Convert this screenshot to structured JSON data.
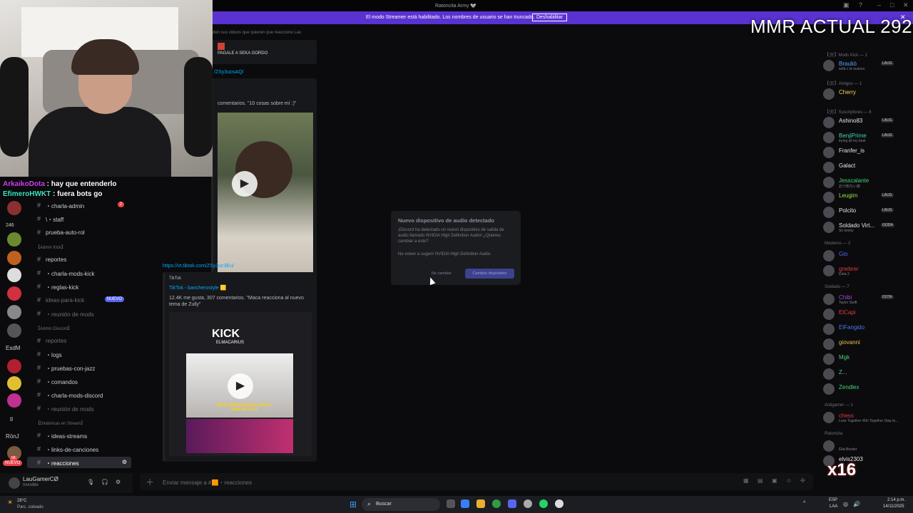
{
  "window": {
    "title": "Ratoncita Army 🐭"
  },
  "banner": {
    "text": "El modo Streamer está habilitado. Los nombres de usuario se han truncado.",
    "button": "Deshabilitar"
  },
  "overlay": {
    "mmr": "MMR ACTUAL 292",
    "x16": "x16"
  },
  "stream_chat": [
    {
      "user": "ArkaikoDota",
      "text": "hay que entenderlo"
    },
    {
      "user": "EfimeroHWKT",
      "text": "fuera bots go"
    }
  ],
  "server_rail": {
    "labels": [
      "246",
      "EsdM",
      "tl",
      "RönJ"
    ],
    "nuevo": "NUEVO",
    "badge": "68"
  },
  "channels": {
    "items": [
      {
        "label": "・charla-admin",
        "badge": "2"
      },
      {
        "label": "\\・staff"
      },
      {
        "label": "prueba-auto-rol"
      },
      {
        "category": "【Admin Kick】"
      },
      {
        "label": "reportes"
      },
      {
        "label": "・charla-mods-kick"
      },
      {
        "label": "・reglas-kick"
      },
      {
        "label": "ideas-para-kick",
        "badge": "NUEVO",
        "dim": true
      },
      {
        "label": "・reunión de mods",
        "dim": true
      },
      {
        "category": "【Admin Discord】"
      },
      {
        "label": "reportes",
        "dim": true
      },
      {
        "label": "・logs"
      },
      {
        "label": "・pruebas-con-jazz"
      },
      {
        "label": "・comandos"
      },
      {
        "label": "・charla-mods-discord"
      },
      {
        "label": "・reunión de mods",
        "dim": true
      },
      {
        "category": "【Dinámicas en Stream】"
      },
      {
        "label": "・ideas-streams"
      },
      {
        "label": "・links-de-canciones"
      },
      {
        "label": "・reacciones",
        "selected": true
      }
    ]
  },
  "user": {
    "name": "LauGamerCØ",
    "status": "Invisible"
  },
  "topic": "den sus videos que quieren que reaccione Lau",
  "messages": {
    "embed1_title": "PAGALE A SEKA GORDO",
    "link1": "/ZSy3uosAQ/",
    "embed2_desc": "comentarios. \"10 cosas sobre mí :)\"",
    "link2": "https://vt.tiktok.com/ZSy3uc3Eu/",
    "embed3_provider": "TikTok",
    "embed3_title": "TikTok - bancherostyle 🟨",
    "embed3_desc": "12.4K me gusta, 307 comentarios. \"Maca reacciona al nuevo tema de Zully\"",
    "thumb_kick": "KICK",
    "thumb_sub": "ELMACARIUS",
    "thumb_caption": "MAQUI REACCIONA AL NUEVO TEMA DE ZULLY"
  },
  "modal": {
    "title": "Nuevo dispositivo de audio detectado",
    "body": "¡Discord ha detectado un nuevo dispositivo de salida de audio llamado NVIDIA High Definition Audio! ¿Quieres cambiar a este?",
    "checkbox": "No volver a sugerir NVIDIA High Definition Audio.",
    "cancel": "No cambiar",
    "confirm": "Cambiar dispositivo"
  },
  "composer": {
    "placeholder": "Enviar mensaje a #🟧・reacciones"
  },
  "members": {
    "groups": [
      {
        "header": "【🛠】Mods Kick — 1",
        "members": [
          {
            "name": "Braulió",
            "status": "sefa c te avanzo",
            "color": "#5aa0ff",
            "tag": "LAUG"
          }
        ]
      },
      {
        "header": "【🛠】Amigos — 1",
        "members": [
          {
            "name": "Cherry",
            "color": "#ffd24a"
          }
        ]
      },
      {
        "header": "【🛠】Suscriptores — 8",
        "members": [
          {
            "name": "Ashino83",
            "color": "#e6e6e6",
            "tag": "LAUG"
          },
          {
            "name": "BenjiPrime",
            "status": "trying all my best",
            "color": "#3fd4b0",
            "tag": "LAUG"
          },
          {
            "name": "Franfer_is",
            "color": "#e6e6e6"
          },
          {
            "name": "Galact",
            "color": "#e6e6e6"
          },
          {
            "name": "Jesscalante",
            "status": "お汁粉ない旅",
            "color": "#4ad07a"
          },
          {
            "name": "Leugim",
            "color": "#9ae64a",
            "tag": "LAUG"
          },
          {
            "name": "Polcito",
            "color": "#e6e6e6",
            "tag": "LAUG"
          },
          {
            "name": "Soldado Virt...",
            "status": "So lonely",
            "color": "#e6e6e6",
            "tag": "GODA"
          }
        ]
      },
      {
        "header": "Moderno — 2",
        "members": [
          {
            "name": "Gio",
            "color": "#5865f2"
          },
          {
            "name": "gnebrer",
            "status": "Dota 2",
            "color": "#e03a3a"
          }
        ]
      },
      {
        "header": "Soldado — 7",
        "members": [
          {
            "name": "Chibi",
            "status": "Taylor Swift",
            "color": "#a04ad0",
            "tag": "DOTA"
          },
          {
            "name": "ElCapi",
            "color": "#e03a3a"
          },
          {
            "name": "ElFangido",
            "color": "#4a7ae6"
          },
          {
            "name": "giovanni",
            "color": "#e6c04a"
          },
          {
            "name": "Mgk",
            "color": "#4ad07a"
          },
          {
            "name": "Z...",
            "color": "#4ad07a"
          },
          {
            "name": "Zendlex",
            "color": "#4ad07a"
          }
        ]
      },
      {
        "header": "Antigamer — 1",
        "members": [
          {
            "name": "chess",
            "status": "Lose Together Win Together Stay to...",
            "color": "#e03a3a"
          }
        ]
      },
      {
        "header": "Ratoncita",
        "members": [
          {
            "name": "",
            "status": "Ella-Besitor",
            "color": "#e6e6e6"
          },
          {
            "name": "elvis2303",
            "color": "#e6e6e6"
          }
        ]
      }
    ]
  },
  "taskbar": {
    "weather_temp": "28°C",
    "weather_desc": "Parc. soleado",
    "search": "Buscar",
    "lang": "ESP",
    "lang2": "LAA",
    "time": "2:14 p.m.",
    "date": "14/11/2025"
  }
}
